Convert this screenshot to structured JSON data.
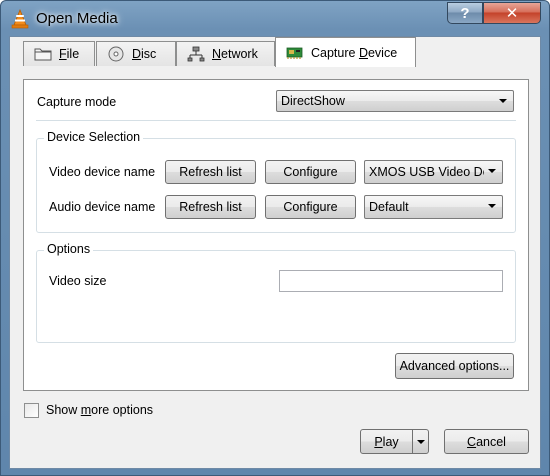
{
  "window": {
    "title": "Open Media",
    "help_label": "?",
    "close_label": "✕"
  },
  "tabs": [
    {
      "label_pre": "",
      "label_u": "F",
      "label_post": "ile",
      "icon": "folder-icon",
      "active": false
    },
    {
      "label_pre": "",
      "label_u": "D",
      "label_post": "isc",
      "icon": "disc-icon",
      "active": false
    },
    {
      "label_pre": "",
      "label_u": "N",
      "label_post": "etwork",
      "icon": "network-icon",
      "active": false
    },
    {
      "label_pre": "Capture ",
      "label_u": "D",
      "label_post": "evice",
      "icon": "capture-card-icon",
      "active": true
    }
  ],
  "capture": {
    "mode_label": "Capture mode",
    "mode_value": "DirectShow",
    "device_selection_title": "Device Selection",
    "video_label": "Video device name",
    "audio_label": "Audio device name",
    "refresh_label": "Refresh list",
    "configure_label": "Configure",
    "video_device_value": "XMOS USB Video De",
    "audio_device_value": "Default",
    "options_title": "Options",
    "video_size_label": "Video size",
    "video_size_value": "",
    "advanced_label": "Advanced options..."
  },
  "footer": {
    "show_more_pre": "Show ",
    "show_more_u": "m",
    "show_more_post": "ore options",
    "show_more_checked": false,
    "play_u": "P",
    "play_post": "lay",
    "cancel_u": "C",
    "cancel_post": "ancel"
  },
  "colors": {
    "title_bar": "#6b90b4",
    "close_button": "#c4422a",
    "dialog_bg": "#f0f0f0"
  }
}
